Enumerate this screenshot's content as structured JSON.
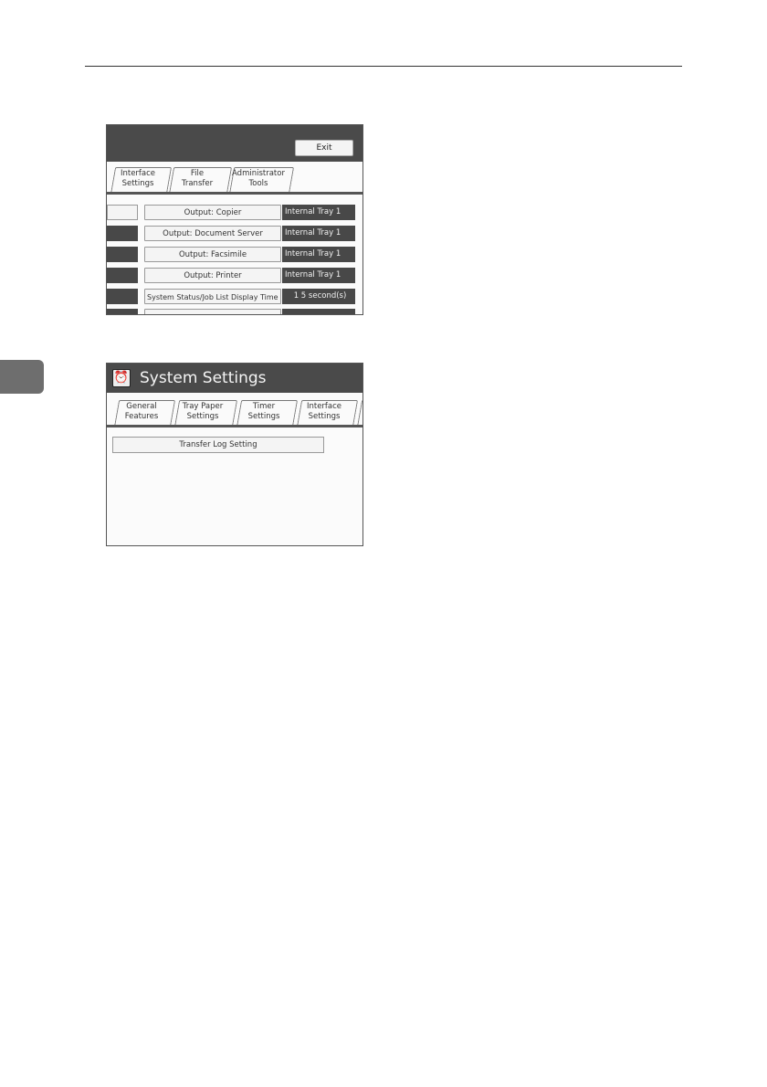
{
  "screen1": {
    "exit_label": "Exit",
    "tabs": [
      {
        "label": "Interface\nSettings"
      },
      {
        "label": "File\nTransfer"
      },
      {
        "label": "Administrator\nTools"
      }
    ],
    "rows": [
      {
        "label": "Output: Copier",
        "value": "Internal Tray 1"
      },
      {
        "label": "Output: Document Server",
        "value": "Internal Tray 1"
      },
      {
        "label": "Output: Facsimile",
        "value": "Internal Tray 1"
      },
      {
        "label": "Output: Printer",
        "value": "Internal Tray 1"
      },
      {
        "label": "System Status/Job List Display Time",
        "value": "1 5 second(s)"
      }
    ]
  },
  "screen2": {
    "title": "System Settings",
    "tabs": [
      {
        "label": "General\nFeatures"
      },
      {
        "label": "Tray Paper\nSettings"
      },
      {
        "label": "Timer\nSettings"
      },
      {
        "label": "Interface\nSettings"
      }
    ],
    "transfer_log_label": "Transfer Log Setting"
  }
}
